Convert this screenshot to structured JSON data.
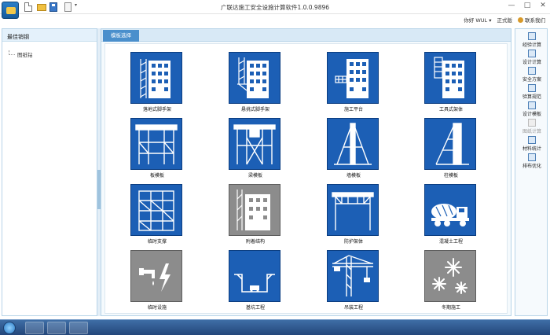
{
  "window": {
    "title": "广联达施工安全设施计算软件1.0.0.9896",
    "minimize": "—",
    "maximize": "□",
    "close": "✕"
  },
  "userbar": {
    "user": "你好 WUL ▾",
    "edition": "正式版",
    "contact": "联系我们"
  },
  "left_panel": {
    "header": "最佳销钢",
    "tree_item": "图纸钻"
  },
  "tab": {
    "label": "模板选择"
  },
  "tiles": [
    {
      "label": "落地式脚手架",
      "icon": "building-scaffold-icon",
      "bg": "#1c5fb5"
    },
    {
      "label": "悬挑式脚手架",
      "icon": "cantilever-scaffold-icon",
      "bg": "#1c5fb5"
    },
    {
      "label": "施工平台",
      "icon": "construction-platform-icon",
      "bg": "#1c5fb5"
    },
    {
      "label": "工具式架体",
      "icon": "tool-frame-icon",
      "bg": "#1c5fb5"
    },
    {
      "label": "板模板",
      "icon": "slab-formwork-icon",
      "bg": "#1c5fb5"
    },
    {
      "label": "梁模板",
      "icon": "beam-formwork-icon",
      "bg": "#1c5fb5"
    },
    {
      "label": "墙模板",
      "icon": "wall-formwork-icon",
      "bg": "#1c5fb5"
    },
    {
      "label": "柱模板",
      "icon": "column-formwork-icon",
      "bg": "#1c5fb5"
    },
    {
      "label": "临时支撑",
      "icon": "temporary-support-icon",
      "bg": "#1c5fb5"
    },
    {
      "label": "附着结构",
      "icon": "attached-structure-icon",
      "bg": "#8c8c8c"
    },
    {
      "label": "防护架体",
      "icon": "protective-frame-icon",
      "bg": "#1c5fb5"
    },
    {
      "label": "混凝土工程",
      "icon": "concrete-mixer-truck-icon",
      "bg": "#1c5fb5"
    },
    {
      "label": "临时设施",
      "icon": "water-electric-icon",
      "bg": "#8c8c8c"
    },
    {
      "label": "基坑工程",
      "icon": "foundation-pit-icon",
      "bg": "#1c5fb5"
    },
    {
      "label": "吊装工程",
      "icon": "tower-crane-icon",
      "bg": "#1c5fb5"
    },
    {
      "label": "冬期施工",
      "icon": "snowflake-icon",
      "bg": "#8c8c8c"
    }
  ],
  "right_toolbar": [
    {
      "label": "经验计算",
      "icon": "magnifier-icon",
      "enabled": true
    },
    {
      "label": "设计计算",
      "icon": "calculator-icon",
      "enabled": true
    },
    {
      "label": "安全方案",
      "icon": "document-icon",
      "enabled": true
    },
    {
      "label": "验算规范",
      "icon": "check-icon",
      "enabled": true
    },
    {
      "label": "设计模板",
      "icon": "template-icon",
      "enabled": true
    },
    {
      "label": "图纸计算",
      "icon": "grid-icon",
      "enabled": false
    },
    {
      "label": "材料统计",
      "icon": "bar-chart-icon",
      "enabled": true
    },
    {
      "label": "排布优化",
      "icon": "layout-icon",
      "enabled": true
    }
  ]
}
